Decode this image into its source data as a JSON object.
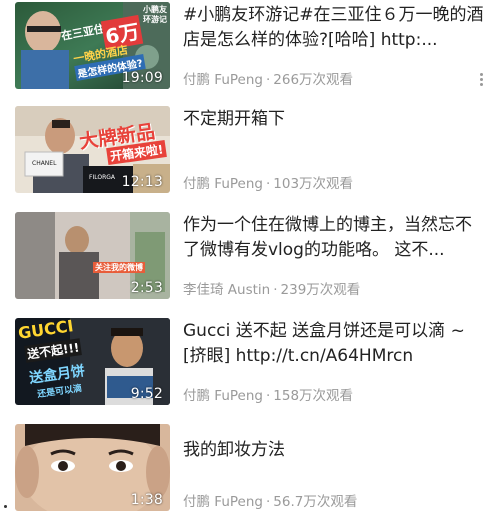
{
  "videos": [
    {
      "title": "#小鹏友环游记#在三亚住６万一晚的酒店是怎么样的体验?[哈哈]  http:...",
      "author": "付鹏 FuPeng",
      "views": "266万次观看",
      "duration": "19:09",
      "thumb_text": [
        "在三亚住",
        "6万",
        "一晚的酒店",
        "是怎样的体验?",
        "小鹏友",
        "环游记"
      ],
      "more_icon": "more-dots-icon"
    },
    {
      "title": "不定期开箱下",
      "author": "付鹏 FuPeng",
      "views": "103万次观看",
      "duration": "12:13",
      "thumb_text": [
        "大牌新品",
        "开箱来啦!",
        "FILORGA",
        "CHANEL"
      ]
    },
    {
      "title": "作为一个住在微博上的博主，当然忘不了微博有发vlog的功能咯。 这不...",
      "author": "李佳琦 Austin",
      "views": "239万次观看",
      "duration": "2:53",
      "thumb_text": [
        "关注我的微博"
      ]
    },
    {
      "title": "Gucci 送不起 送盒月饼还是可以滴 ~[挤眼] http://t.cn/A64HMrcn",
      "author": "付鹏 FuPeng",
      "views": "158万次观看",
      "duration": "9:52",
      "thumb_text": [
        "GUCCI",
        "送不起!!!",
        "送盒月饼",
        "还是可以滴"
      ]
    },
    {
      "title": "我的卸妆方法",
      "author": "付鹏 FuPeng",
      "views": "56.7万次观看",
      "duration": "1:38",
      "thumb_text": []
    }
  ],
  "separator": "·",
  "colors": {
    "meta": "#9a9a9a",
    "title": "#222222",
    "duration": "#ffffff"
  }
}
